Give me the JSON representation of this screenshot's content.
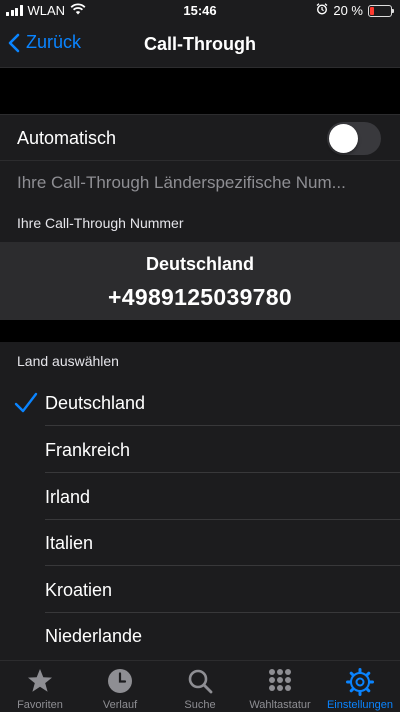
{
  "status_bar": {
    "carrier": "WLAN",
    "time": "15:46",
    "battery_percent": "20 %",
    "battery_level": 0.2,
    "battery_color": "#ff3b30"
  },
  "nav": {
    "back_label": "Zurück",
    "title": "Call-Through"
  },
  "settings": {
    "automatic_label": "Automatisch",
    "automatic_enabled": false,
    "country_number_placeholder": "Ihre Call-Through Länderspezifische Num...",
    "number_section_header": "Ihre Call-Through Nummer",
    "selected_country": "Deutschland",
    "call_through_number": "+4989125039780",
    "select_country_header": "Land auswählen"
  },
  "countries": [
    {
      "name": "Deutschland",
      "selected": true
    },
    {
      "name": "Frankreich",
      "selected": false
    },
    {
      "name": "Irland",
      "selected": false
    },
    {
      "name": "Italien",
      "selected": false
    },
    {
      "name": "Kroatien",
      "selected": false
    },
    {
      "name": "Niederlande",
      "selected": false
    }
  ],
  "tab_bar": {
    "tabs": [
      {
        "label": "Favoriten",
        "icon": "star-icon",
        "active": false
      },
      {
        "label": "Verlauf",
        "icon": "clock-icon",
        "active": false
      },
      {
        "label": "Suche",
        "icon": "search-icon",
        "active": false
      },
      {
        "label": "Wahltastatur",
        "icon": "keypad-icon",
        "active": false
      },
      {
        "label": "Einstellungen",
        "icon": "gear-icon",
        "active": true
      }
    ]
  },
  "colors": {
    "accent": "#0a84ff",
    "background": "#000000",
    "cell": "#1c1c1e",
    "number_card": "#2c2c2e",
    "secondary_text": "#8e8e93"
  }
}
